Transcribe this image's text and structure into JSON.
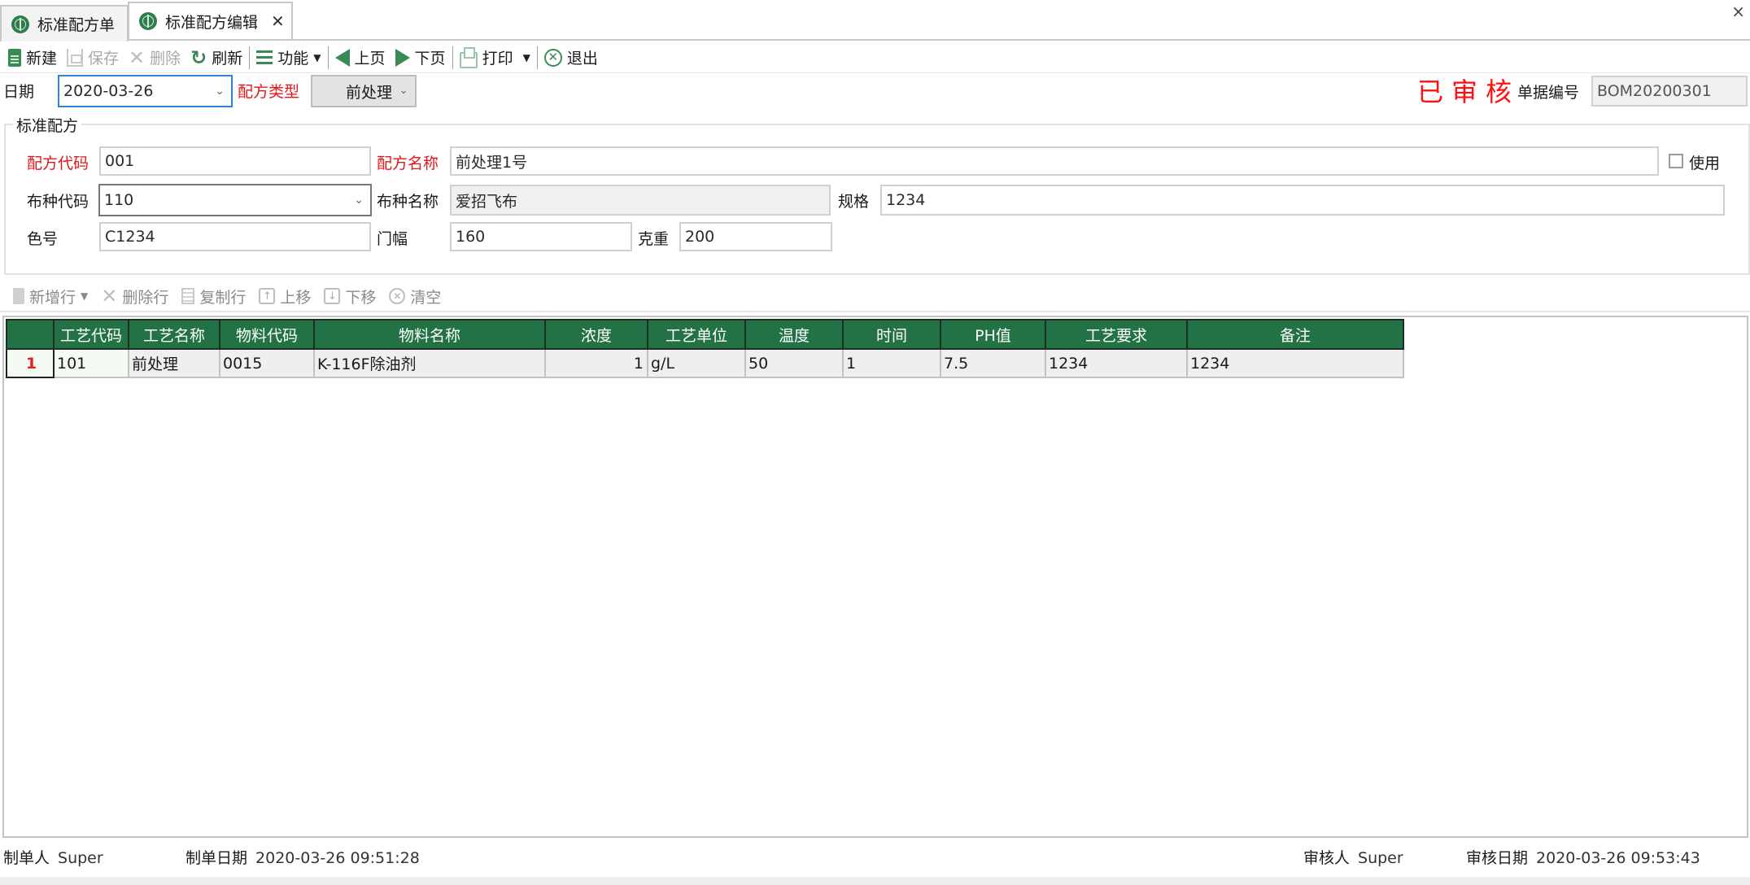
{
  "tabs": [
    {
      "label": "标准配方单",
      "icon": "globe-icon",
      "active": false
    },
    {
      "label": "标准配方编辑",
      "icon": "globe-icon",
      "active": true,
      "closable": true
    }
  ],
  "window": {
    "close_glyph": "×"
  },
  "toolbar": {
    "new": "新建",
    "save": "保存",
    "delete": "删除",
    "refresh": "刷新",
    "function": "功能",
    "prev_page": "上页",
    "next_page": "下页",
    "print": "打印",
    "exit": "退出"
  },
  "header": {
    "date_label": "日期",
    "date_value": "2020-03-26",
    "type_label": "配方类型",
    "type_value": "前处理",
    "status_stamp": "已审核",
    "doc_no_label": "单据编号",
    "doc_no_value": "BOM20200301"
  },
  "group": {
    "title": "标准配方",
    "recipe_code_label": "配方代码",
    "recipe_code_value": "001",
    "recipe_name_label": "配方名称",
    "recipe_name_value": "前处理1号",
    "use_label": "使用",
    "use_checked": false,
    "fabric_code_label": "布种代码",
    "fabric_code_value": "110",
    "fabric_name_label": "布种名称",
    "fabric_name_value": "爱招飞布",
    "spec_label": "规格",
    "spec_value": "1234",
    "color_no_label": "色号",
    "color_no_value": "C1234",
    "width_label": "门幅",
    "width_value": "160",
    "weight_label": "克重",
    "weight_value": "200"
  },
  "grid_toolbar": {
    "add_row": "新增行",
    "delete_row": "删除行",
    "copy_row": "复制行",
    "move_up": "上移",
    "move_down": "下移",
    "clear": "清空"
  },
  "grid": {
    "columns": [
      "工艺代码",
      "工艺名称",
      "物料代码",
      "物料名称",
      "浓度",
      "工艺单位",
      "温度",
      "时间",
      "PH值",
      "工艺要求",
      "备注"
    ],
    "rows": [
      {
        "row_no": "1",
        "cells": [
          "101",
          "前处理",
          "0015",
          "K-116F除油剂",
          "1",
          "g/L",
          "50",
          "1",
          "7.5",
          "1234",
          "1234"
        ]
      }
    ]
  },
  "footer": {
    "creator_label": "制单人",
    "creator_value": "Super",
    "created_label": "制单日期",
    "created_value": "2020-03-26 09:51:28",
    "auditor_label": "审核人",
    "auditor_value": "Super",
    "audited_label": "审核日期",
    "audited_value": "2020-03-26 09:53:43"
  },
  "colors": {
    "accent_green": "#227246",
    "required_red": "#e4161a",
    "stamp_red": "#ff1010",
    "focus_blue": "#2e83d6"
  }
}
